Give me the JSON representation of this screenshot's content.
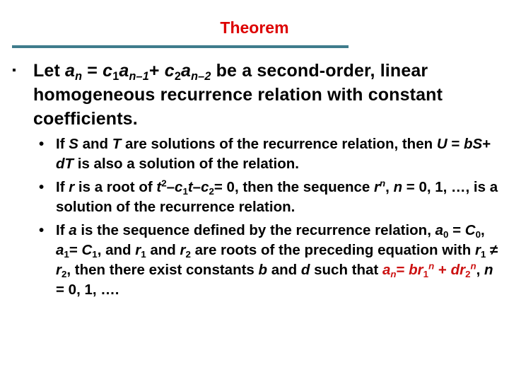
{
  "title": "Theorem",
  "accent_color": "#dd0000",
  "rule_color": "#3f7c8c",
  "main_point": {
    "bullet": "▪",
    "parts": {
      "let": "Let ",
      "a": "a",
      "n": "n",
      "eq": " = ",
      "c1": "c",
      "one": "1",
      "a2": "a",
      "nm1": "n–1",
      "plus": "+ ",
      "c2": "c",
      "two": "2",
      "a3": "a",
      "nm2": "n–2",
      "rest": " be a second-order, linear homogeneous recurrence relation with constant coefficients."
    }
  },
  "sub_points": [
    {
      "bullet": "•",
      "p1": "If ",
      "S": "S",
      "p2": " and ",
      "T": "T",
      "p3": " are solutions of the recurrence relation, then ",
      "U": "U",
      "p4": " = ",
      "b": "b",
      "S2": "S",
      "p5": "+ ",
      "d": "d",
      "T2": "T",
      "p6": " is also a solution of the relation."
    },
    {
      "bullet": "•",
      "p1": "If ",
      "r": "r",
      "p2": " is a root of ",
      "t": "t",
      "sq": "2",
      "m1": "–",
      "c1": "c",
      "one": "1",
      "t2": "t",
      "m2": "–",
      "c2": "c",
      "two": "2",
      "p3": "= 0, then the sequence ",
      "r2": "r",
      "n": "n",
      "p4": ", ",
      "n2": "n",
      "p5": " = 0, 1, …, is a solution of the recurrence relation."
    },
    {
      "bullet": "•",
      "p1": "If ",
      "a": "a",
      "p2": " is the sequence defined by the recurrence relation, ",
      "a0": "a",
      "zero": "0",
      "p3": " = ",
      "C0": "C",
      "zero2": "0",
      "p4": ", ",
      "a1": "a",
      "one": "1",
      "p5": "= ",
      "C1": "C",
      "one2": "1",
      "p6": ", and ",
      "r1": "r",
      "one3": "1",
      "p7": " and ",
      "r2": "r",
      "two": "2",
      "p8": " are roots of the preceding equation with ",
      "r1b": "r",
      "one4": "1",
      "neq": " ≠ ",
      "r2b": "r",
      "two2": "2",
      "p9": ", then there exist constants ",
      "b": "b",
      "p10": " and ",
      "d": "d",
      "p11": " such that ",
      "formula": {
        "a": "a",
        "n": "n",
        "eq": "= ",
        "b": "br",
        "one": "1",
        "n2": "n",
        "plus": " + ",
        "d": "dr",
        "two": "2",
        "n3": "n"
      },
      "p12": ",  ",
      "n": "n",
      "p13": " = 0, 1, …."
    }
  ]
}
